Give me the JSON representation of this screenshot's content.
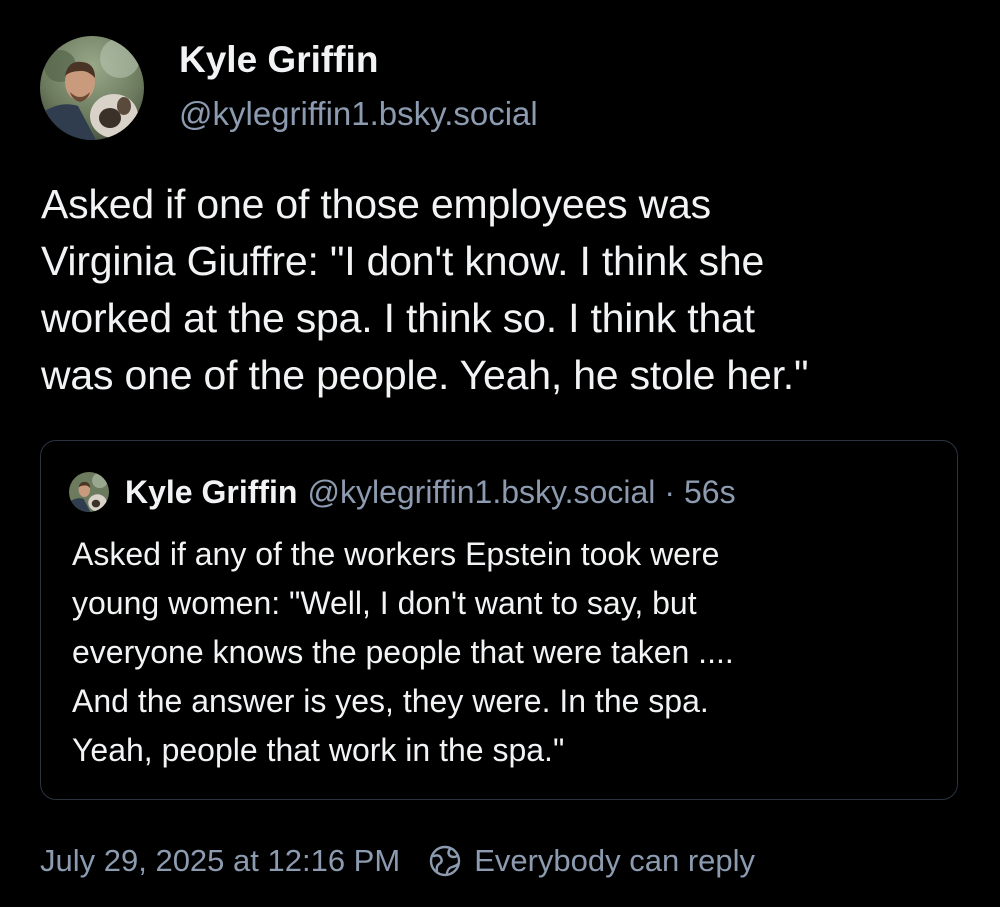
{
  "post": {
    "author": {
      "display_name": "Kyle Griffin",
      "handle": "@kylegriffin1.bsky.social"
    },
    "text": "Asked if one of those employees was\nVirginia Giuffre: \"I don't know. I think she\nworked at the spa. I think so. I think that\nwas one of the people. Yeah, he stole her.\"",
    "quote": {
      "author": {
        "display_name": "Kyle Griffin",
        "handle": "@kylegriffin1.bsky.social"
      },
      "separator": "·",
      "time": "56s",
      "text": "Asked if any of the workers Epstein took were\nyoung women: \"Well, I don't want to say, but\neveryone knows the people that were taken ....\nAnd the answer is yes, they were. In the spa.\nYeah, people that work in the spa.\""
    },
    "timestamp": "July 29, 2025 at 12:16 PM",
    "reply_setting": {
      "label": "Everybody can reply",
      "icon": "globe-icon"
    }
  },
  "colors": {
    "background": "#000000",
    "primary_text": "#f1f3f5",
    "secondary_text": "#8c9bb0",
    "quote_border": "#2a3340"
  }
}
